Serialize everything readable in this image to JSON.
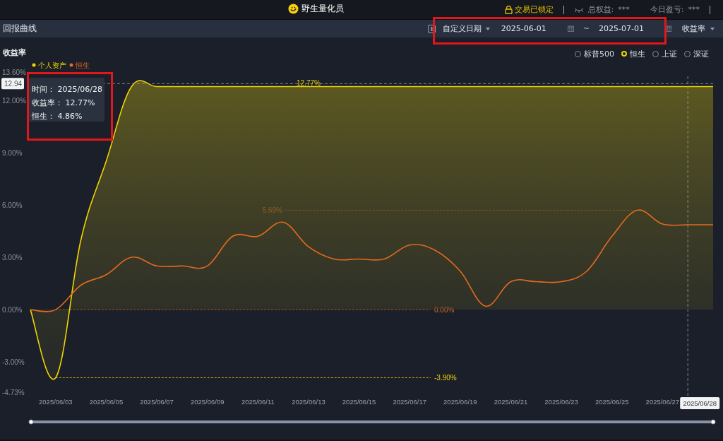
{
  "app_bar": {
    "title": "野生量化员",
    "lock_status": "交易已锁定",
    "total_equity_label": "总权益:",
    "total_equity_value": "***",
    "today_pnl_label": "今日盈亏:",
    "today_pnl_value": "***"
  },
  "toolbar": {
    "title": "回报曲线",
    "date_mode": "自定义日期",
    "start_date": "2025-06-01",
    "separator": "~",
    "end_date": "2025-07-01",
    "metric": "收益率"
  },
  "chart": {
    "title": "收益率",
    "benchmarks": [
      {
        "label": "标普500",
        "selected": false
      },
      {
        "label": "恒生",
        "selected": true
      },
      {
        "label": "上证",
        "selected": false
      },
      {
        "label": "深证",
        "selected": false
      }
    ],
    "tooltip": {
      "rows": [
        {
          "label": "时间：",
          "value": "2025/06/28"
        },
        {
          "label": "收益率：",
          "value": "12.77%"
        },
        {
          "label": "恒生：",
          "value": "4.86%"
        }
      ]
    },
    "pointer": {
      "y_label": "12.94",
      "x_label": "2025/06/28"
    },
    "chart_data": {
      "type": "line",
      "categories": [
        null,
        "2025/06/03",
        null,
        "2025/06/05",
        null,
        "2025/06/07",
        null,
        "2025/06/09",
        null,
        "2025/06/11",
        null,
        "2025/06/13",
        null,
        "2025/06/15",
        null,
        "2025/06/17",
        null,
        "2025/06/19",
        null,
        "2025/06/21",
        null,
        "2025/06/23",
        null,
        "2025/06/25",
        null,
        "2025/06/27",
        null,
        null
      ],
      "series": [
        {
          "name": "个人资产",
          "color": "#f0d400",
          "type": "area",
          "values": [
            0,
            -3.9,
            4.0,
            8.5,
            12.77,
            12.77,
            12.77,
            12.77,
            12.77,
            12.77,
            12.77,
            12.77,
            12.77,
            12.77,
            12.77,
            12.77,
            12.77,
            12.77,
            12.77,
            12.77,
            12.77,
            12.77,
            12.77,
            12.77,
            12.77,
            12.77,
            12.77,
            12.77
          ]
        },
        {
          "name": "恒生",
          "color": "#e36a1e",
          "values": [
            0,
            0,
            1.4,
            2.0,
            3.0,
            2.5,
            2.5,
            2.5,
            4.2,
            4.2,
            5.0,
            3.6,
            2.9,
            2.9,
            2.9,
            3.7,
            3.4,
            2.2,
            0.2,
            1.6,
            1.6,
            1.6,
            2.2,
            4.2,
            5.69,
            4.9,
            4.86,
            4.86
          ]
        }
      ],
      "ylim": [
        -4.73,
        13.6
      ],
      "yticks": [
        {
          "value": 13.6,
          "label": "13.60%"
        },
        {
          "value": 12,
          "label": "12.00%"
        },
        {
          "value": 9,
          "label": "9.00%"
        },
        {
          "value": 6,
          "label": "6.00%"
        },
        {
          "value": 3,
          "label": "3.00%"
        },
        {
          "value": 0,
          "label": "0.00%"
        },
        {
          "value": -3,
          "label": "-3.00%"
        },
        {
          "value": -4.73,
          "label": "-4.73%"
        }
      ],
      "annotations": [
        {
          "text": "12.77%",
          "x": "2025/06/13",
          "y": 12.77
        },
        "5.69%",
        {
          "text": "0.00%",
          "x": "2025/06/03",
          "y": 0
        },
        {
          "text": "-3.90%",
          "x": "2025/06/03",
          "y": -3.9
        }
      ]
    }
  },
  "highlights": {
    "date_filter": true,
    "tooltip": true
  }
}
